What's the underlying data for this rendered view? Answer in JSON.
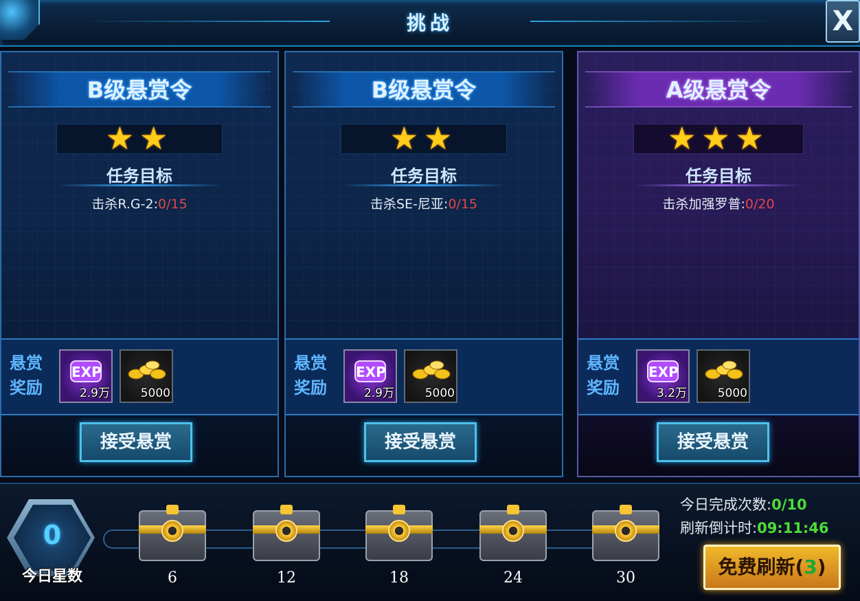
{
  "header": {
    "title": "挑战",
    "close_label": "X"
  },
  "cards": [
    {
      "theme": "blue",
      "title": "B级悬赏令",
      "stars": "★★",
      "objective_label": "任务目标",
      "objective_text": "击杀R.G-2:",
      "objective_progress": "0/15",
      "reward_label_1": "悬赏",
      "reward_label_2": "奖励",
      "exp_icon": "EXP",
      "exp_qty": "2.9万",
      "gold_qty": "5000",
      "accept_label": "接受悬赏"
    },
    {
      "theme": "blue",
      "title": "B级悬赏令",
      "stars": "★★",
      "objective_label": "任务目标",
      "objective_text": "击杀SE-尼亚:",
      "objective_progress": "0/15",
      "reward_label_1": "悬赏",
      "reward_label_2": "奖励",
      "exp_icon": "EXP",
      "exp_qty": "2.9万",
      "gold_qty": "5000",
      "accept_label": "接受悬赏"
    },
    {
      "theme": "purple",
      "title": "A级悬赏令",
      "stars": "★★★",
      "objective_label": "任务目标",
      "objective_text": "击杀加强罗普:",
      "objective_progress": "0/20",
      "reward_label_1": "悬赏",
      "reward_label_2": "奖励",
      "exp_icon": "EXP",
      "exp_qty": "3.2万",
      "gold_qty": "5000",
      "accept_label": "接受悬赏"
    }
  ],
  "bottom": {
    "star_count": "0",
    "star_label": "今日星数",
    "chests": [
      "6",
      "12",
      "18",
      "24",
      "30"
    ],
    "completed_label": "今日完成次数:",
    "completed_value": "0/10",
    "countdown_label": "刷新倒计时:",
    "countdown_value": "09:11:46",
    "refresh_label": "免费刷新(",
    "refresh_count": "3",
    "refresh_close": ")"
  },
  "colors": {
    "accent": "#2aa6ff",
    "progress_red": "#e0484a",
    "timer_green": "#4ddc38",
    "gold": "#ffcc1a"
  }
}
